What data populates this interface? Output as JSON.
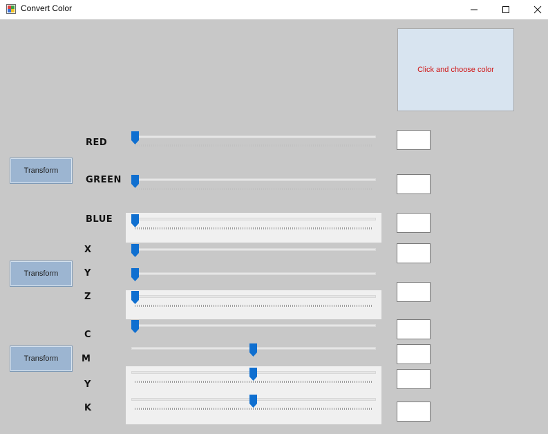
{
  "window": {
    "title": "Convert Color",
    "icons": {
      "app": "app-icon",
      "minimize": "minimize-icon",
      "maximize": "maximize-icon",
      "close": "close-icon"
    }
  },
  "color_picker": {
    "label": "Click and choose color",
    "background": "#d8e4f0",
    "text_color": "#d01414"
  },
  "labels": {
    "red": "RED",
    "green": "GREEN",
    "blue": "BLUE",
    "x": "X",
    "y": "Y",
    "z": "Z",
    "c": "C",
    "m": "M",
    "y2": "Y",
    "k": "K"
  },
  "buttons": {
    "transform_rgb": "Transform",
    "transform_xyz": "Transform",
    "transform_cmyk": "Transform"
  },
  "sliders": {
    "red": 0,
    "green": 0,
    "blue": 0,
    "x": 0,
    "y": 0,
    "z": 0,
    "c": 0,
    "m": 0.5,
    "y2": 0.5,
    "k": 0.5
  },
  "values": {
    "red": "",
    "green": "",
    "blue": "",
    "x": "",
    "y": "",
    "z": "",
    "c": "",
    "m": "",
    "y2": "",
    "k": ""
  },
  "colors": {
    "slider_thumb": "#0f6fd0",
    "button": "#9cb5d1",
    "form_background": "#c8c8c8"
  }
}
